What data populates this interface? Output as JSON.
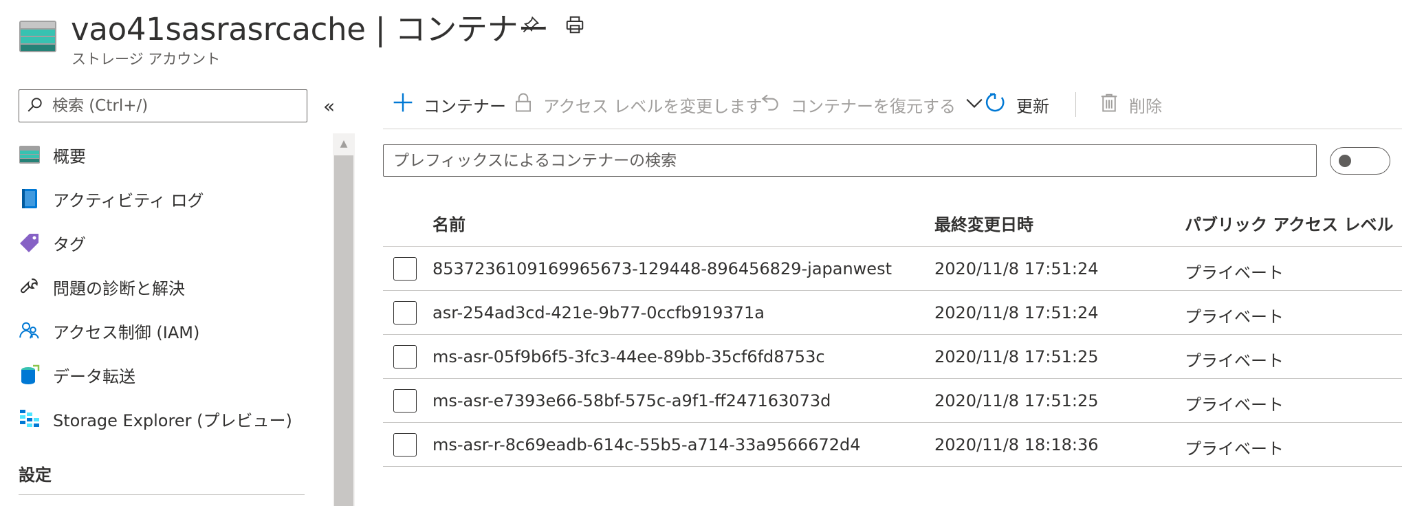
{
  "header": {
    "title": "vao41sasrasrcache | コンテナー",
    "subtitle": "ストレージ アカウント",
    "pin_icon": "pin-icon",
    "print_icon": "print-icon"
  },
  "sidebar": {
    "search_placeholder": "検索 (Ctrl+/)",
    "collapse_label": "«",
    "items": [
      {
        "label": "概要",
        "icon": "overview-icon"
      },
      {
        "label": "アクティビティ ログ",
        "icon": "activity-log-icon"
      },
      {
        "label": "タグ",
        "icon": "tag-icon"
      },
      {
        "label": "問題の診断と解決",
        "icon": "wrench-icon"
      },
      {
        "label": "アクセス制御 (IAM)",
        "icon": "people-icon"
      },
      {
        "label": "データ転送",
        "icon": "data-transfer-icon"
      },
      {
        "label": "Storage Explorer (プレビュー)",
        "icon": "storage-explorer-icon"
      }
    ],
    "section_settings": "設定"
  },
  "toolbar": {
    "add_container": "コンテナー",
    "change_access": "アクセス レベルを変更します",
    "restore": "コンテナーを復元する",
    "refresh": "更新",
    "delete": "削除"
  },
  "filter": {
    "placeholder": "プレフィックスによるコンテナーの検索"
  },
  "table": {
    "headers": {
      "name": "名前",
      "modified": "最終変更日時",
      "access": "パブリック アクセス レベル"
    },
    "rows": [
      {
        "name": "8537236109169965673-129448-896456829-japanwest",
        "modified": "2020/11/8 17:51:24",
        "access": "プライベート"
      },
      {
        "name": "asr-254ad3cd-421e-9b77-0ccfb919371a",
        "modified": "2020/11/8 17:51:24",
        "access": "プライベート"
      },
      {
        "name": "ms-asr-05f9b6f5-3fc3-44ee-89bb-35cf6fd8753c",
        "modified": "2020/11/8 17:51:25",
        "access": "プライベート"
      },
      {
        "name": "ms-asr-e7393e66-58bf-575c-a9f1-ff247163073d",
        "modified": "2020/11/8 17:51:25",
        "access": "プライベート"
      },
      {
        "name": "ms-asr-r-8c69eadb-614c-55b5-a714-33a9566672d4",
        "modified": "2020/11/8 18:18:36",
        "access": "プライベート"
      }
    ]
  },
  "colors": {
    "accent": "#0078d4",
    "text": "#323130",
    "disabled": "#a19f9d"
  }
}
